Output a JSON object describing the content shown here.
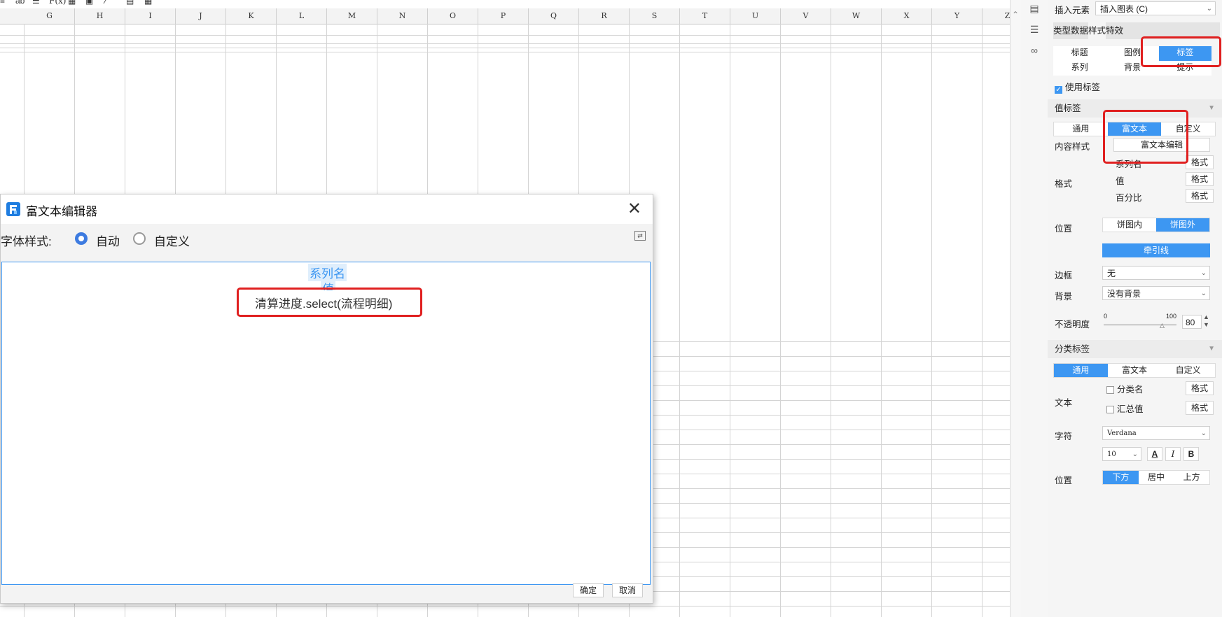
{
  "toolbar": {
    "icons": [
      "align-left-icon",
      "ab-icon",
      "align-icon",
      "function-icon",
      "bar-chart-icon",
      "image-icon",
      "pen-icon",
      "layout-icon",
      "table-icon"
    ],
    "function_label": "F(x)",
    "ab_label": "ab"
  },
  "sheet": {
    "columns": [
      "G",
      "H",
      "I",
      "J",
      "K",
      "L",
      "M",
      "N",
      "O",
      "P",
      "Q",
      "R",
      "S",
      "T",
      "U",
      "V",
      "W",
      "X",
      "Y",
      "Z"
    ]
  },
  "panel": {
    "insert_label": "插入元素",
    "insert_value": "插入图表 (C)",
    "main_tabs": [
      "类型",
      "数据",
      "样式",
      "特效"
    ],
    "active_main_tab": "样式",
    "sub_tabs_row1": [
      "标题",
      "图例",
      "标签"
    ],
    "sub_tabs_row2": [
      "系列",
      "背景",
      "提示"
    ],
    "active_sub_tab": "标签",
    "use_label": "使用标签",
    "value_label_section": "值标签",
    "value_label_modes": [
      "通用",
      "富文本",
      "自定义"
    ],
    "active_value_mode": "富文本",
    "content_style_label": "内容样式",
    "rich_text_edit_button": "富文本编辑",
    "format_label": "格式",
    "format_items": [
      "系列名",
      "值",
      "百分比"
    ],
    "format_button": "格式",
    "position_label": "位置",
    "position_options": [
      "饼图内",
      "饼图外"
    ],
    "active_position": "饼图外",
    "leader_line_button": "牵引线",
    "border_label": "边框",
    "border_value": "无",
    "background_label": "背景",
    "background_value": "没有背景",
    "opacity_label": "不透明度",
    "opacity_min": "0",
    "opacity_max": "100",
    "opacity_value": "80",
    "category_section": "分类标签",
    "category_modes": [
      "通用",
      "富文本",
      "自定义"
    ],
    "active_category_mode": "通用",
    "text_label": "文本",
    "text_items": [
      "分类名",
      "汇总值"
    ],
    "char_label": "字符",
    "font_value": "Verdana",
    "font_size_value": "10",
    "font_buttons": [
      "A",
      "I",
      "B"
    ],
    "position2_label": "位置",
    "position2_options": [
      "下方",
      "居中",
      "上方"
    ],
    "active_position2": "下方"
  },
  "dialog": {
    "title": "富文本编辑器",
    "font_style_label": "字体样式:",
    "radio_auto": "自动",
    "radio_custom": "自定义",
    "selected_radio": "自动",
    "editor_tags": [
      "系列名",
      "值"
    ],
    "formula_text": "清算进度.select(流程明细)",
    "ok_button": "确定",
    "cancel_button": "取消"
  },
  "colors": {
    "accent": "#3d97f2",
    "highlight_red": "#e02020"
  }
}
